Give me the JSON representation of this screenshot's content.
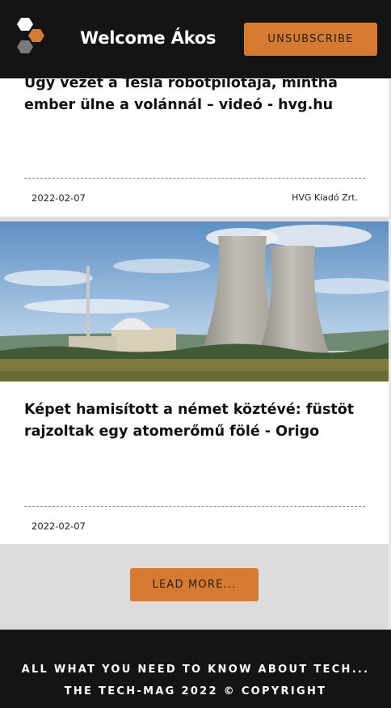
{
  "header": {
    "welcome_text": "Welcome Ákos",
    "unsubscribe_label": "UNSUBSCRIBE",
    "logo_icon": "hexagon-cluster-logo-icon",
    "accent_color": "#d57a30"
  },
  "articles": [
    {
      "title": "Úgy vezet a Tesla robotpilótája, mintha ember ülne a volánnál – videó - hvg.hu",
      "date": "2022-02-07",
      "source": "HVG Kiadó Zrt."
    },
    {
      "title": "Képet hamisított a német köztévé: füstöt rajzoltak egy atomerőmű fölé - Origo",
      "date": "2022-02-07",
      "image": "nuclear-power-plant-cooling-towers-photo"
    }
  ],
  "load_more": {
    "label": "LEAD MORE..."
  },
  "footer": {
    "line1": "ALL WHAT YOU NEED TO KNOW ABOUT TECH...",
    "line2": "THE TECH-MAG 2022 © COPYRIGHT"
  }
}
